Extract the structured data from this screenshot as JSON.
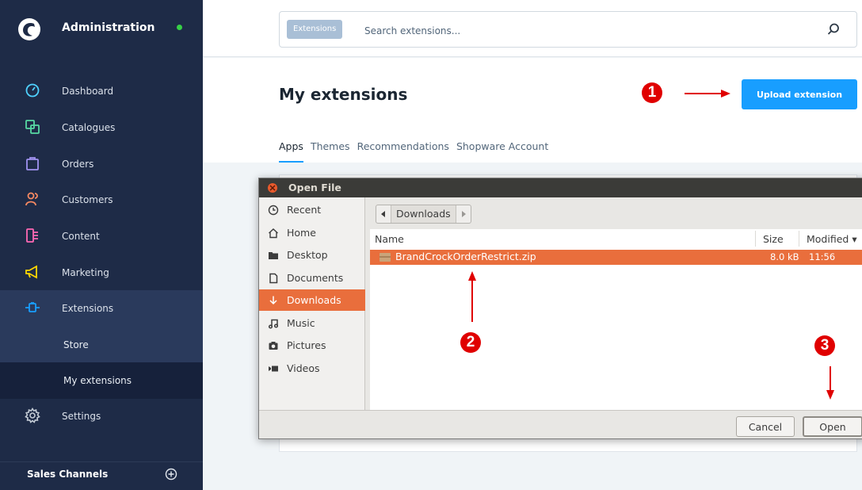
{
  "sidebar": {
    "title": "Administration",
    "items": [
      {
        "label": "Dashboard",
        "icon": "dashboard-gauge-icon"
      },
      {
        "label": "Catalogues",
        "icon": "catalogue-icon"
      },
      {
        "label": "Orders",
        "icon": "shopping-bag-icon"
      },
      {
        "label": "Customers",
        "icon": "customers-icon"
      },
      {
        "label": "Content",
        "icon": "content-layout-icon"
      },
      {
        "label": "Marketing",
        "icon": "megaphone-icon"
      },
      {
        "label": "Extensions",
        "icon": "plug-icon"
      },
      {
        "label": "Store"
      },
      {
        "label": "My extensions"
      },
      {
        "label": "Settings",
        "icon": "gear-icon"
      }
    ],
    "sales_channels_label": "Sales Channels",
    "colors": {
      "background": "#1e2b47",
      "status_dot": "#37d046"
    }
  },
  "search": {
    "chip": "Extensions",
    "placeholder": "Search extensions..."
  },
  "page": {
    "title": "My extensions",
    "upload_button": "Upload extension",
    "tabs": [
      "Apps",
      "Themes",
      "Recommendations",
      "Shopware Account"
    ]
  },
  "dialog": {
    "title": "Open File",
    "places": [
      {
        "label": "Recent",
        "icon": "clock-icon"
      },
      {
        "label": "Home",
        "icon": "home-icon"
      },
      {
        "label": "Desktop",
        "icon": "folder-icon"
      },
      {
        "label": "Documents",
        "icon": "document-icon"
      },
      {
        "label": "Downloads",
        "icon": "download-icon"
      },
      {
        "label": "Music",
        "icon": "music-icon"
      },
      {
        "label": "Pictures",
        "icon": "camera-icon"
      },
      {
        "label": "Videos",
        "icon": "video-icon"
      }
    ],
    "path": "Downloads",
    "columns": {
      "name": "Name",
      "size": "Size",
      "modified": "Modified"
    },
    "file": {
      "name": "BrandCrockOrderRestrict.zip",
      "size": "8.0 kB",
      "modified": "11:56"
    },
    "cancel_button": "Cancel",
    "open_button": "Open",
    "accent": "#e96e3c"
  },
  "annotations": [
    "1",
    "2",
    "3"
  ],
  "colors": {
    "primary": "#189eff",
    "annotation": "#e00000"
  }
}
